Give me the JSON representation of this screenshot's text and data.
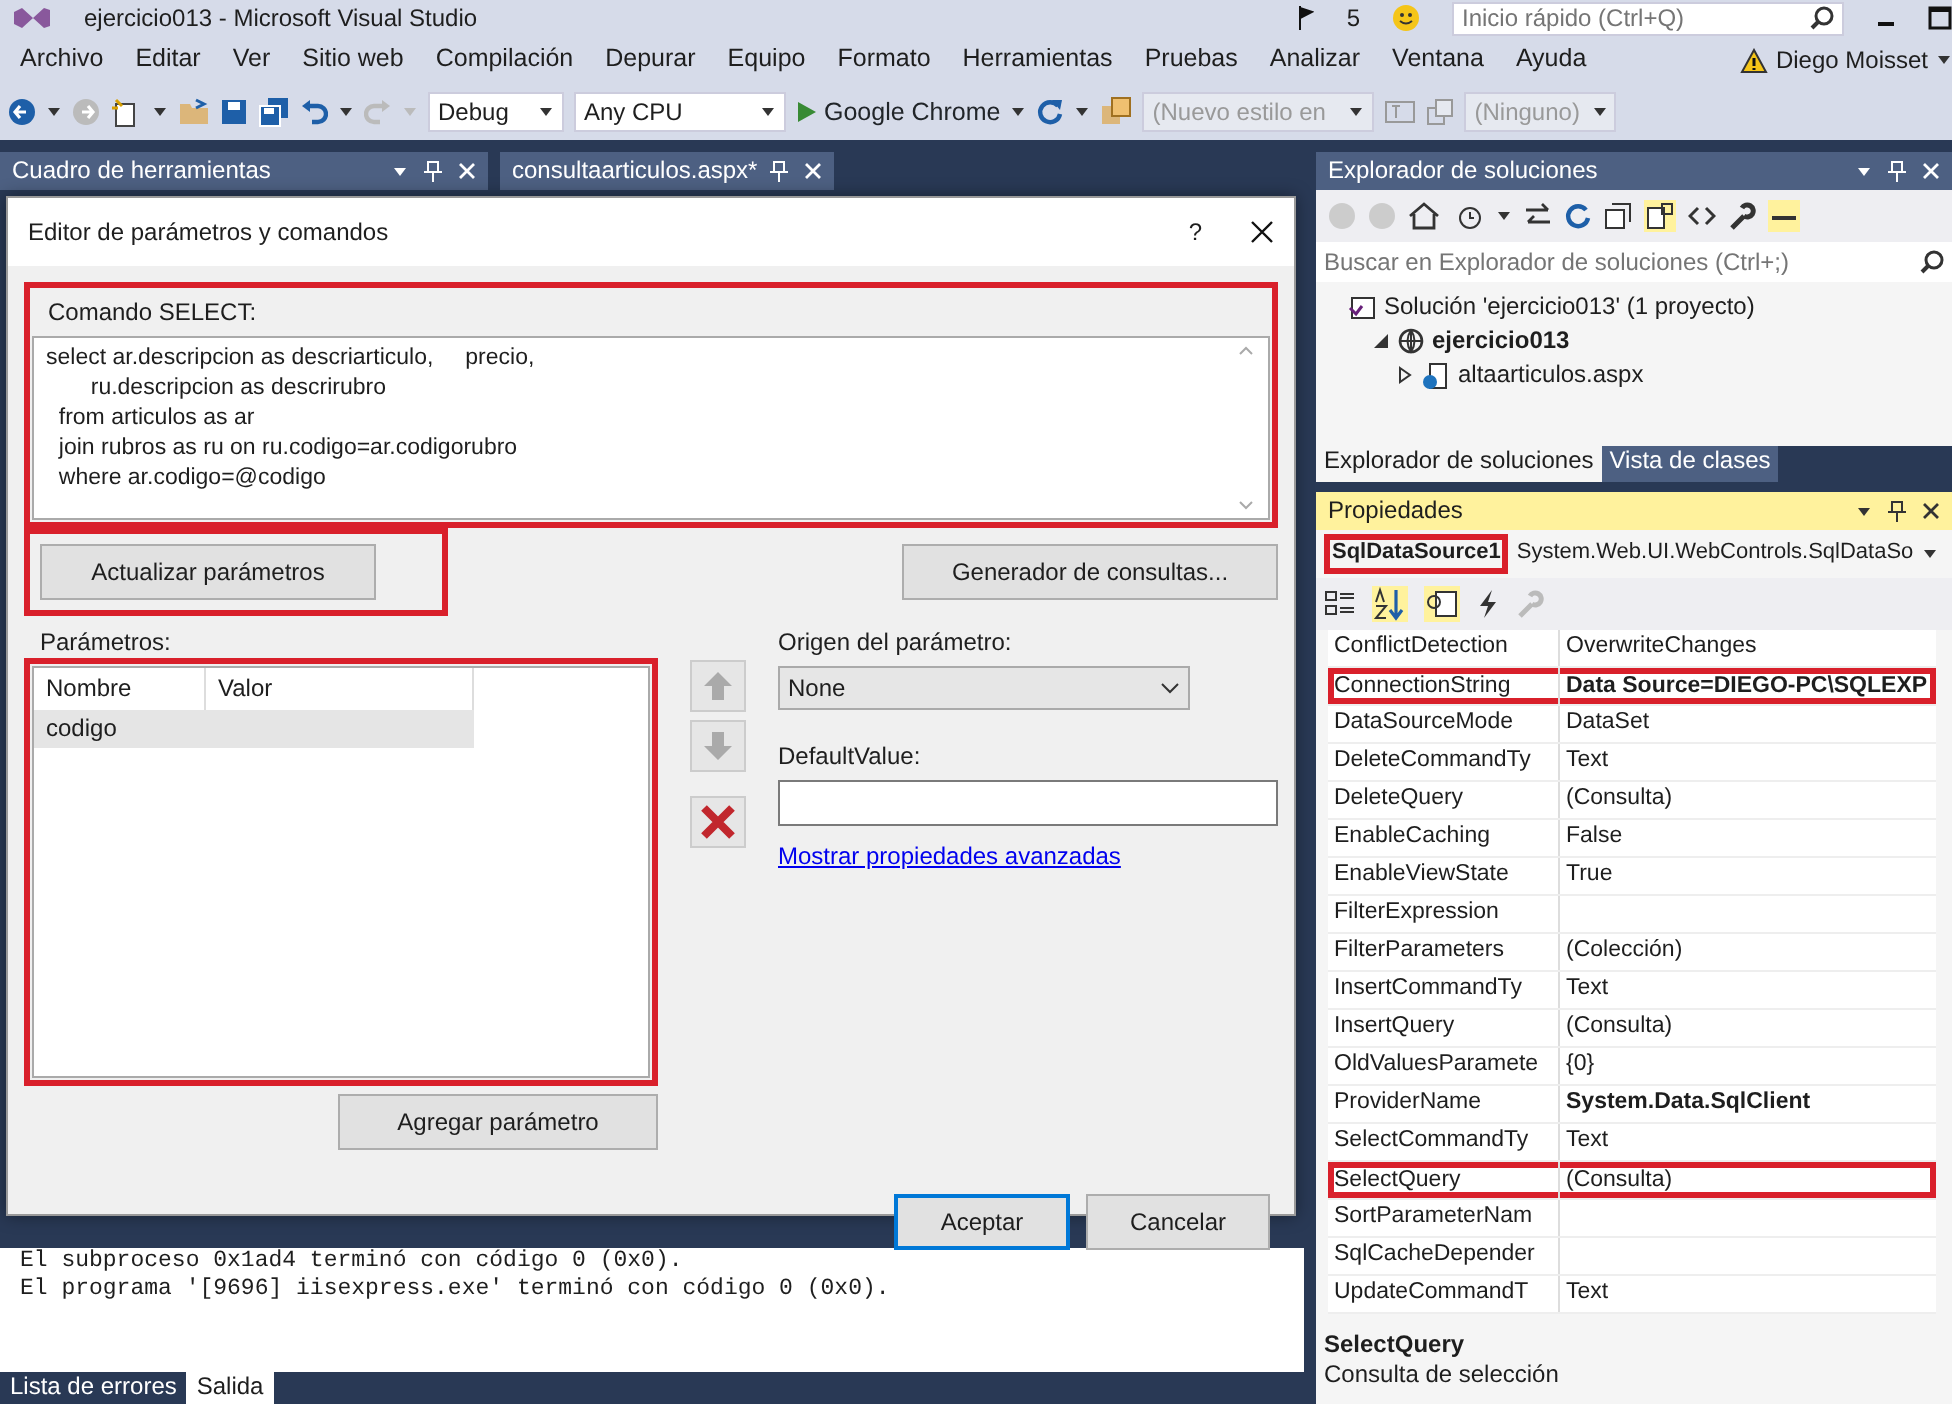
{
  "window": {
    "title": "ejercicio013 - Microsoft Visual Studio",
    "notifications": "5",
    "quick_launch": {
      "placeholder": "Inicio rápido (Ctrl+Q)"
    },
    "user": "Diego Moisset"
  },
  "menu": [
    "Archivo",
    "Editar",
    "Ver",
    "Sitio web",
    "Compilación",
    "Depurar",
    "Equipo",
    "Formato",
    "Herramientas",
    "Pruebas",
    "Analizar",
    "Ventana",
    "Ayuda"
  ],
  "toolbar": {
    "configuration": "Debug",
    "platform": "Any CPU",
    "run_target": "Google Chrome",
    "style": "(Nuevo estilo en",
    "target": "(Ninguno)"
  },
  "doc_tabs": [
    {
      "label": "Cuadro de herramientas",
      "kind": "tool"
    },
    {
      "label": "consultaarticulos.aspx*",
      "kind": "document"
    }
  ],
  "output": {
    "lines": [
      "El subproceso 0x1ad4 terminó con código 0 (0x0).",
      "El programa '[9696] iisexpress.exe' terminó con código 0 (0x0)."
    ]
  },
  "bottom_tabs": [
    {
      "label": "Lista de errores",
      "selected": false
    },
    {
      "label": "Salida",
      "selected": true
    }
  ],
  "dialog": {
    "title": "Editor de parámetros y comandos",
    "help": "?",
    "command_label": "Comando SELECT:",
    "command_highlighted": true,
    "command": "select ar.descripcion as descriarticulo,     precio,\n       ru.descripcion as descrirubro\n  from articulos as ar\n  join rubros as ru on ru.codigo=ar.codigorubro\n  where ar.codigo=@codigo",
    "refresh_button": "Actualizar parámetros",
    "refresh_highlighted": true,
    "query_builder_button": "Generador de consultas...",
    "parameters_label": "Parámetros:",
    "parameters_highlighted": true,
    "columns": [
      "Nombre",
      "Valor"
    ],
    "parameters": [
      {
        "name": "codigo",
        "selected": true
      }
    ],
    "source_label": "Origen del parámetro:",
    "source": "None",
    "default_label": "DefaultValue:",
    "advanced_link": "Mostrar propiedades avanzadas",
    "add_button": "Agregar parámetro",
    "ok_button": "Aceptar",
    "cancel_button": "Cancelar"
  },
  "solution_explorer": {
    "title": "Explorador de soluciones",
    "search": {
      "placeholder": "Buscar en Explorador de soluciones (Ctrl+;)"
    },
    "tree": [
      {
        "label": "Solución 'ejercicio013'  (1 proyecto)",
        "kind": "solution",
        "children": [
          {
            "label": "ejercicio013",
            "kind": "project",
            "expanded": true,
            "children": [
              {
                "label": "altaarticulos.aspx",
                "kind": "page",
                "expanded": false
              }
            ]
          }
        ]
      }
    ],
    "tabs": [
      {
        "label": "Explorador de soluciones",
        "selected": true
      },
      {
        "label": "Vista de clases",
        "selected": false
      }
    ]
  },
  "properties": {
    "title": "Propiedades",
    "object": "SqlDataSource1",
    "object_highlighted": true,
    "type": "System.Web.UI.WebControls.SqlDataSo",
    "rows": [
      {
        "name": "ConflictDetection",
        "value": "OverwriteChanges",
        "bold": false,
        "highlighted": false
      },
      {
        "name": "ConnectionString",
        "value": "Data Source=DIEGO-PC\\SQLEXP",
        "bold": true,
        "highlighted": true
      },
      {
        "name": "DataSourceMode",
        "value": "DataSet",
        "bold": false,
        "highlighted": false
      },
      {
        "name": "DeleteCommandTy",
        "value": "Text",
        "bold": false,
        "highlighted": false
      },
      {
        "name": "DeleteQuery",
        "value": "(Consulta)",
        "bold": false,
        "highlighted": false
      },
      {
        "name": "EnableCaching",
        "value": "False",
        "bold": false,
        "highlighted": false
      },
      {
        "name": "EnableViewState",
        "value": "True",
        "bold": false,
        "highlighted": false
      },
      {
        "name": "FilterExpression",
        "highlighted": false
      },
      {
        "name": "FilterParameters",
        "value": "(Colección)",
        "bold": false,
        "highlighted": false
      },
      {
        "name": "InsertCommandTy",
        "value": "Text",
        "bold": false,
        "highlighted": false
      },
      {
        "name": "InsertQuery",
        "value": "(Consulta)",
        "bold": false,
        "highlighted": false
      },
      {
        "name": "OldValuesParamete",
        "value": "{0}",
        "bold": false,
        "highlighted": false
      },
      {
        "name": "ProviderName",
        "value": "System.Data.SqlClient",
        "bold": true,
        "highlighted": false
      },
      {
        "name": "SelectCommandTy",
        "value": "Text",
        "bold": false,
        "highlighted": false
      },
      {
        "name": "SelectQuery",
        "value": "(Consulta)",
        "bold": false,
        "highlighted": true
      },
      {
        "name": "SortParameterNam",
        "highlighted": false
      },
      {
        "name": "SqlCacheDepender",
        "highlighted": false
      },
      {
        "name": "UpdateCommandT",
        "value": "Text",
        "bold": false,
        "highlighted": false
      }
    ],
    "description_title": "SelectQuery",
    "description": "Consulta de selección"
  }
}
